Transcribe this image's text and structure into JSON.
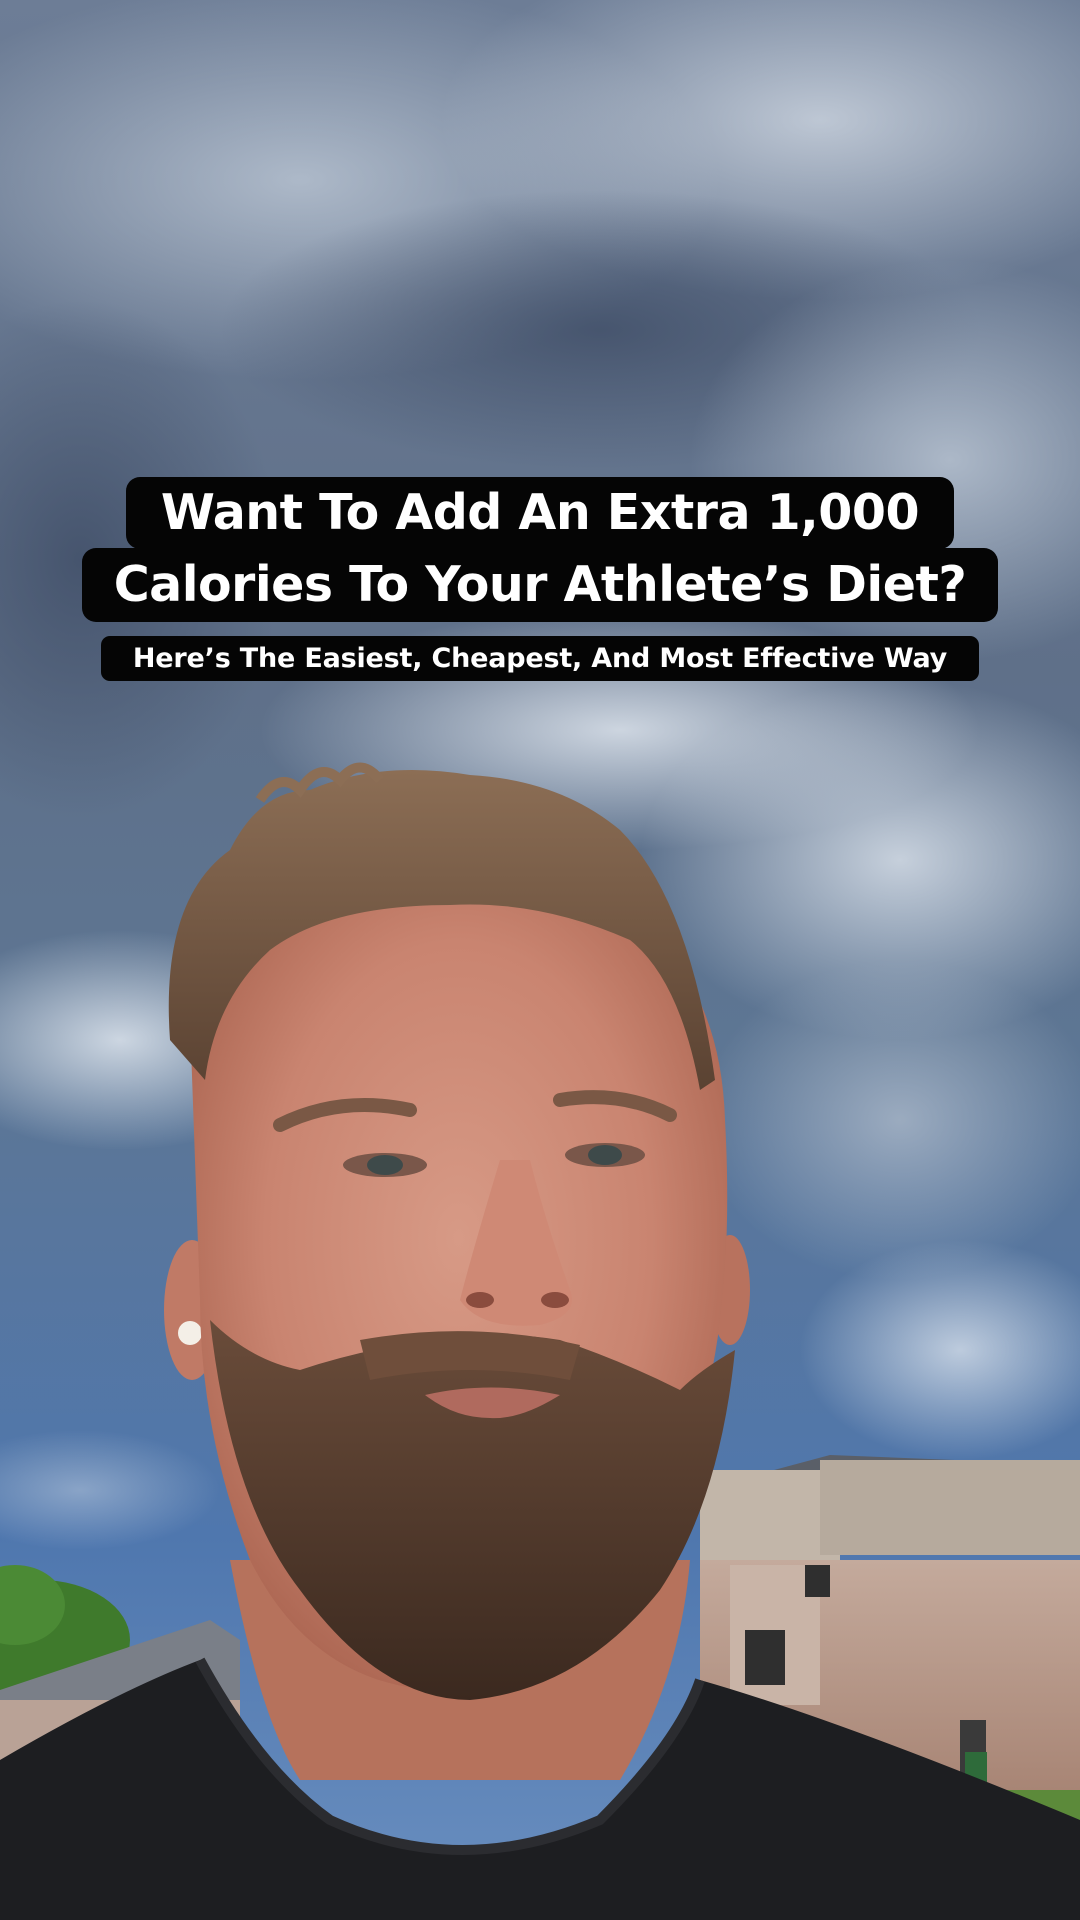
{
  "caption": {
    "title_line_1": "Want To Add An Extra 1,000",
    "title_line_2": "Calories To Your Athlete’s Diet?",
    "subtitle": "Here’s The Easiest, Cheapest, And Most Effective Way"
  },
  "colors": {
    "caption_background": "#050505",
    "caption_text": "#ffffff",
    "sky": "#5f7aa0",
    "shirt": "#1d1e21",
    "building": "#b49587"
  }
}
